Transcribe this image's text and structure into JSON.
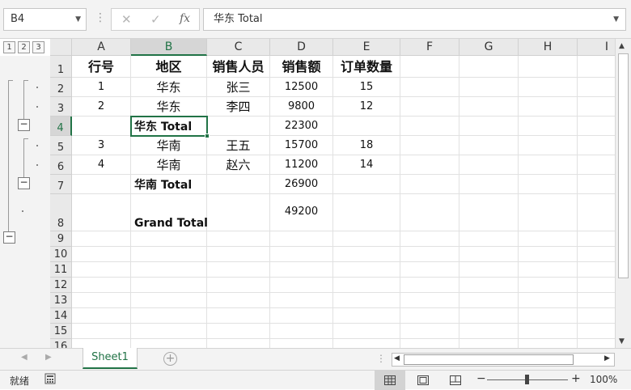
{
  "formula_bar": {
    "name_box": "B4",
    "formula": "华东 Total",
    "cancel_icon": "✕",
    "enter_icon": "✓",
    "fx_label": "fx"
  },
  "outline_levels": [
    "1",
    "2",
    "3"
  ],
  "columns": [
    "A",
    "B",
    "C",
    "D",
    "E",
    "F",
    "G",
    "H",
    "I"
  ],
  "rows": [
    "1",
    "2",
    "3",
    "4",
    "5",
    "6",
    "7",
    "8",
    "9",
    "10",
    "11",
    "12",
    "13",
    "14",
    "15",
    "16"
  ],
  "table": {
    "headers": [
      "行号",
      "地区",
      "销售人员",
      "销售额",
      "订单数量"
    ],
    "rows": [
      [
        "1",
        "华东",
        "张三",
        "12500",
        "15"
      ],
      [
        "2",
        "华东",
        "李四",
        "9800",
        "12"
      ],
      [
        "",
        "华东 Total",
        "",
        "22300",
        ""
      ],
      [
        "3",
        "华南",
        "王五",
        "15700",
        "18"
      ],
      [
        "4",
        "华南",
        "赵六",
        "11200",
        "14"
      ],
      [
        "",
        "华南 Total",
        "",
        "26900",
        ""
      ],
      [
        "",
        "Grand Total",
        "",
        "49200",
        ""
      ]
    ]
  },
  "selection": {
    "active_cell": "B4",
    "selected_column": "B",
    "selected_row": "4"
  },
  "sheets": {
    "tabs": [
      "Sheet1"
    ],
    "add_label": "+"
  },
  "status_bar": {
    "ready": "就绪",
    "zoom": "100%",
    "zoom_minus": "−",
    "zoom_plus": "+"
  },
  "colors": {
    "accent": "#217346",
    "header_bg": "#e9e9e9",
    "grid_line": "#e1e1e1"
  }
}
